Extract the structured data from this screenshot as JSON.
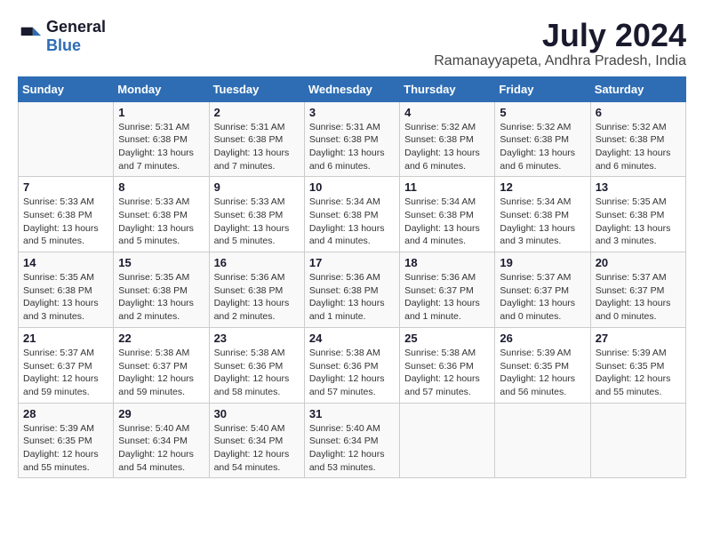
{
  "logo": {
    "line1": "General",
    "line2": "Blue"
  },
  "title": "July 2024",
  "location": "Ramanayyapeta, Andhra Pradesh, India",
  "headers": [
    "Sunday",
    "Monday",
    "Tuesday",
    "Wednesday",
    "Thursday",
    "Friday",
    "Saturday"
  ],
  "weeks": [
    [
      {
        "day": "",
        "info": ""
      },
      {
        "day": "1",
        "info": "Sunrise: 5:31 AM\nSunset: 6:38 PM\nDaylight: 13 hours\nand 7 minutes."
      },
      {
        "day": "2",
        "info": "Sunrise: 5:31 AM\nSunset: 6:38 PM\nDaylight: 13 hours\nand 7 minutes."
      },
      {
        "day": "3",
        "info": "Sunrise: 5:31 AM\nSunset: 6:38 PM\nDaylight: 13 hours\nand 6 minutes."
      },
      {
        "day": "4",
        "info": "Sunrise: 5:32 AM\nSunset: 6:38 PM\nDaylight: 13 hours\nand 6 minutes."
      },
      {
        "day": "5",
        "info": "Sunrise: 5:32 AM\nSunset: 6:38 PM\nDaylight: 13 hours\nand 6 minutes."
      },
      {
        "day": "6",
        "info": "Sunrise: 5:32 AM\nSunset: 6:38 PM\nDaylight: 13 hours\nand 6 minutes."
      }
    ],
    [
      {
        "day": "7",
        "info": "Sunrise: 5:33 AM\nSunset: 6:38 PM\nDaylight: 13 hours\nand 5 minutes."
      },
      {
        "day": "8",
        "info": "Sunrise: 5:33 AM\nSunset: 6:38 PM\nDaylight: 13 hours\nand 5 minutes."
      },
      {
        "day": "9",
        "info": "Sunrise: 5:33 AM\nSunset: 6:38 PM\nDaylight: 13 hours\nand 5 minutes."
      },
      {
        "day": "10",
        "info": "Sunrise: 5:34 AM\nSunset: 6:38 PM\nDaylight: 13 hours\nand 4 minutes."
      },
      {
        "day": "11",
        "info": "Sunrise: 5:34 AM\nSunset: 6:38 PM\nDaylight: 13 hours\nand 4 minutes."
      },
      {
        "day": "12",
        "info": "Sunrise: 5:34 AM\nSunset: 6:38 PM\nDaylight: 13 hours\nand 3 minutes."
      },
      {
        "day": "13",
        "info": "Sunrise: 5:35 AM\nSunset: 6:38 PM\nDaylight: 13 hours\nand 3 minutes."
      }
    ],
    [
      {
        "day": "14",
        "info": "Sunrise: 5:35 AM\nSunset: 6:38 PM\nDaylight: 13 hours\nand 3 minutes."
      },
      {
        "day": "15",
        "info": "Sunrise: 5:35 AM\nSunset: 6:38 PM\nDaylight: 13 hours\nand 2 minutes."
      },
      {
        "day": "16",
        "info": "Sunrise: 5:36 AM\nSunset: 6:38 PM\nDaylight: 13 hours\nand 2 minutes."
      },
      {
        "day": "17",
        "info": "Sunrise: 5:36 AM\nSunset: 6:38 PM\nDaylight: 13 hours\nand 1 minute."
      },
      {
        "day": "18",
        "info": "Sunrise: 5:36 AM\nSunset: 6:37 PM\nDaylight: 13 hours\nand 1 minute."
      },
      {
        "day": "19",
        "info": "Sunrise: 5:37 AM\nSunset: 6:37 PM\nDaylight: 13 hours\nand 0 minutes."
      },
      {
        "day": "20",
        "info": "Sunrise: 5:37 AM\nSunset: 6:37 PM\nDaylight: 13 hours\nand 0 minutes."
      }
    ],
    [
      {
        "day": "21",
        "info": "Sunrise: 5:37 AM\nSunset: 6:37 PM\nDaylight: 12 hours\nand 59 minutes."
      },
      {
        "day": "22",
        "info": "Sunrise: 5:38 AM\nSunset: 6:37 PM\nDaylight: 12 hours\nand 59 minutes."
      },
      {
        "day": "23",
        "info": "Sunrise: 5:38 AM\nSunset: 6:36 PM\nDaylight: 12 hours\nand 58 minutes."
      },
      {
        "day": "24",
        "info": "Sunrise: 5:38 AM\nSunset: 6:36 PM\nDaylight: 12 hours\nand 57 minutes."
      },
      {
        "day": "25",
        "info": "Sunrise: 5:38 AM\nSunset: 6:36 PM\nDaylight: 12 hours\nand 57 minutes."
      },
      {
        "day": "26",
        "info": "Sunrise: 5:39 AM\nSunset: 6:35 PM\nDaylight: 12 hours\nand 56 minutes."
      },
      {
        "day": "27",
        "info": "Sunrise: 5:39 AM\nSunset: 6:35 PM\nDaylight: 12 hours\nand 55 minutes."
      }
    ],
    [
      {
        "day": "28",
        "info": "Sunrise: 5:39 AM\nSunset: 6:35 PM\nDaylight: 12 hours\nand 55 minutes."
      },
      {
        "day": "29",
        "info": "Sunrise: 5:40 AM\nSunset: 6:34 PM\nDaylight: 12 hours\nand 54 minutes."
      },
      {
        "day": "30",
        "info": "Sunrise: 5:40 AM\nSunset: 6:34 PM\nDaylight: 12 hours\nand 54 minutes."
      },
      {
        "day": "31",
        "info": "Sunrise: 5:40 AM\nSunset: 6:34 PM\nDaylight: 12 hours\nand 53 minutes."
      },
      {
        "day": "",
        "info": ""
      },
      {
        "day": "",
        "info": ""
      },
      {
        "day": "",
        "info": ""
      }
    ]
  ]
}
